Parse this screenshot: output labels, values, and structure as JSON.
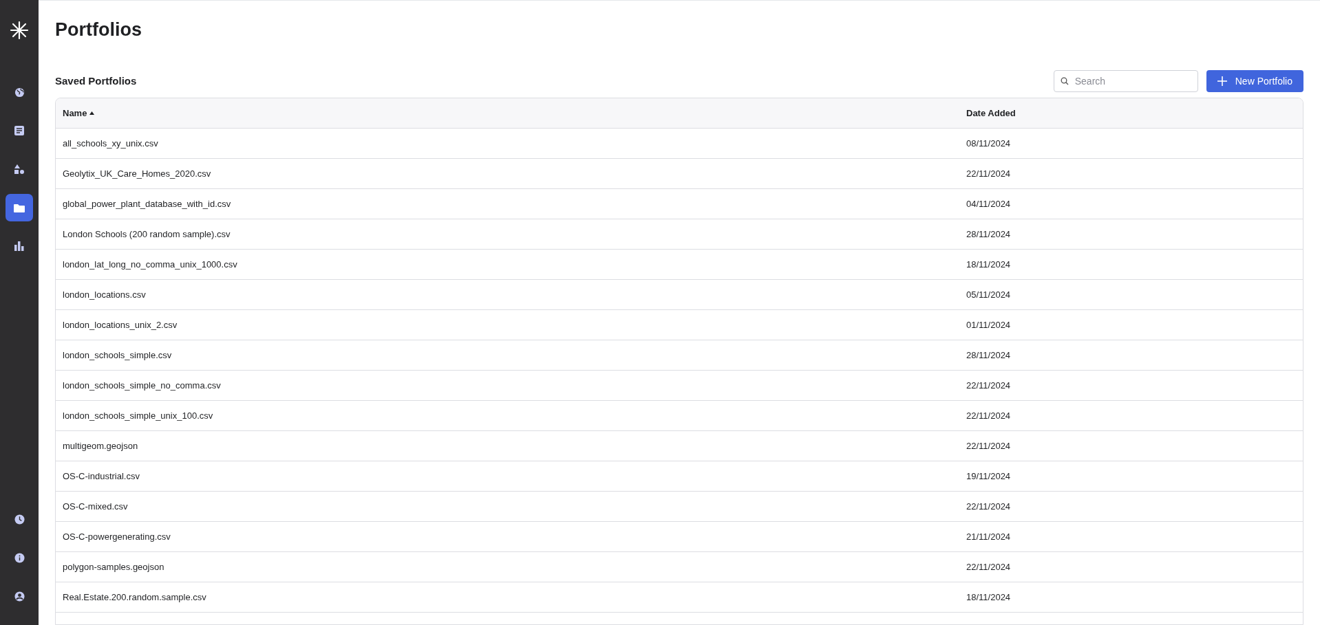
{
  "sidebar": {
    "top_items": [
      {
        "selected": false
      },
      {
        "selected": false
      },
      {
        "selected": false
      },
      {
        "selected": true
      },
      {
        "selected": false
      }
    ],
    "bottom_items": [
      {
        "selected": false
      },
      {
        "selected": false
      },
      {
        "selected": false
      }
    ]
  },
  "page": {
    "title": "Portfolios",
    "section_title": "Saved Portfolios",
    "search": {
      "placeholder": "Search"
    },
    "new_button": "New Portfolio"
  },
  "table": {
    "columns": [
      {
        "label": "Name",
        "sorted": true
      },
      {
        "label": "Date Added",
        "sorted": false
      }
    ],
    "rows": [
      {
        "name": "all_schools_xy_unix.csv",
        "date": "08/11/2024"
      },
      {
        "name": "Geolytix_UK_Care_Homes_2020.csv",
        "date": "22/11/2024"
      },
      {
        "name": "global_power_plant_database_with_id.csv",
        "date": "04/11/2024"
      },
      {
        "name": "London Schools (200 random sample).csv",
        "date": "28/11/2024"
      },
      {
        "name": "london_lat_long_no_comma_unix_1000.csv",
        "date": "18/11/2024"
      },
      {
        "name": "london_locations.csv",
        "date": "05/11/2024"
      },
      {
        "name": "london_locations_unix_2.csv",
        "date": "01/11/2024"
      },
      {
        "name": "london_schools_simple.csv",
        "date": "28/11/2024"
      },
      {
        "name": "london_schools_simple_no_comma.csv",
        "date": "22/11/2024"
      },
      {
        "name": "london_schools_simple_unix_100.csv",
        "date": "22/11/2024"
      },
      {
        "name": "multigeom.geojson",
        "date": "22/11/2024"
      },
      {
        "name": "OS-C-industrial.csv",
        "date": "19/11/2024"
      },
      {
        "name": "OS-C-mixed.csv",
        "date": "22/11/2024"
      },
      {
        "name": "OS-C-powergenerating.csv",
        "date": "21/11/2024"
      },
      {
        "name": "polygon-samples.geojson",
        "date": "22/11/2024"
      },
      {
        "name": "Real.Estate.200.random.sample.csv",
        "date": "18/11/2024"
      }
    ]
  }
}
